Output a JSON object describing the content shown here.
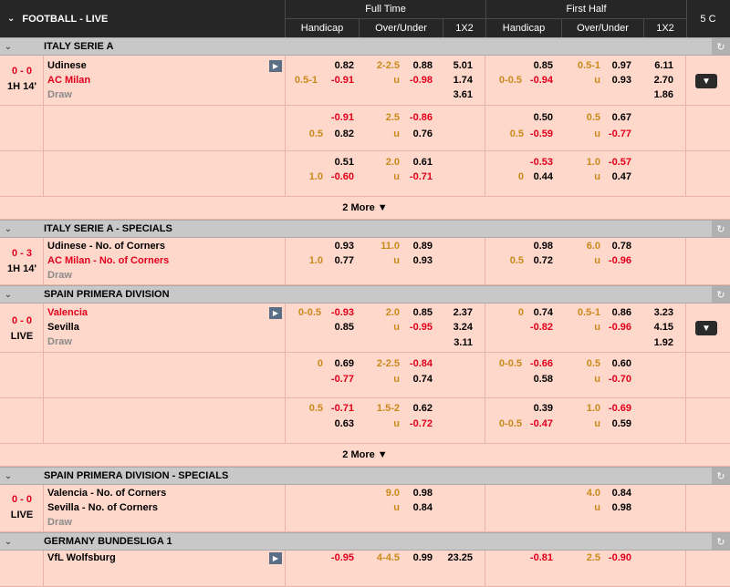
{
  "header": {
    "title": "FOOTBALL - LIVE",
    "full_time": "Full Time",
    "first_half": "First Half",
    "handicap": "Handicap",
    "over_under": "Over/Under",
    "x12": "1X2",
    "count": "5",
    "refresh_glyph": "C"
  },
  "more_label": "2 More ▼",
  "leagues": {
    "l1": "ITALY SERIE A",
    "l2": "ITALY SERIE A - SPECIALS",
    "l3": "SPAIN PRIMERA DIVISION",
    "l4": "SPAIN PRIMERA DIVISION - SPECIALS",
    "l5": "GERMANY BUNDESLIGA 1"
  },
  "m1": {
    "score": "0 - 0",
    "clock": "1H 14'",
    "home": "Udinese",
    "away": "AC Milan",
    "draw": "Draw",
    "r1": {
      "ft_hdp_line": "",
      "ft_hdp": "0.82",
      "ft_ou_line": "2-2.5",
      "ft_ou": "0.88",
      "ft_1x2": "5.01",
      "fh_hdp_line": "",
      "fh_hdp": "0.85",
      "fh_ou_line": "0.5-1",
      "fh_ou": "0.97",
      "fh_1x2": "6.11"
    },
    "r2": {
      "ft_hdp_line": "0.5-1",
      "ft_hdp": "-0.91",
      "ft_ou_line": "u",
      "ft_ou": "-0.98",
      "ft_1x2": "1.74",
      "fh_hdp_line": "0-0.5",
      "fh_hdp": "-0.94",
      "fh_ou_line": "u",
      "fh_ou": "0.93",
      "fh_1x2": "2.70"
    },
    "r3": {
      "ft_1x2": "3.61",
      "fh_1x2": "1.86"
    },
    "alt1": {
      "a_ft_hdp": "-0.91",
      "a_ft_ou_line": "2.5",
      "a_ft_ou": "-0.86",
      "a_fh_hdp": "0.50",
      "a_fh_ou_line": "0.5",
      "a_fh_ou": "0.67",
      "b_ft_hdp_line": "0.5",
      "b_ft_hdp": "0.82",
      "b_ft_ou_line": "u",
      "b_ft_ou": "0.76",
      "b_fh_hdp_line": "0.5",
      "b_fh_hdp": "-0.59",
      "b_fh_ou_line": "u",
      "b_fh_ou": "-0.77"
    },
    "alt2": {
      "a_ft_hdp": "0.51",
      "a_ft_ou_line": "2.0",
      "a_ft_ou": "0.61",
      "a_fh_hdp": "-0.53",
      "a_fh_ou_line": "1.0",
      "a_fh_ou": "-0.57",
      "b_ft_hdp_line": "1.0",
      "b_ft_hdp": "-0.60",
      "b_ft_ou_line": "u",
      "b_ft_ou": "-0.71",
      "b_fh_hdp_line": "0",
      "b_fh_hdp": "0.44",
      "b_fh_ou_line": "u",
      "b_fh_ou": "0.47"
    }
  },
  "m2": {
    "score": "0 - 3",
    "clock": "1H 14'",
    "home": "Udinese - No. of Corners",
    "away": "AC Milan - No. of Corners",
    "draw": "Draw",
    "r1": {
      "ft_hdp": "0.93",
      "ft_ou_line": "11.0",
      "ft_ou": "0.89",
      "fh_hdp": "0.98",
      "fh_ou_line": "6.0",
      "fh_ou": "0.78"
    },
    "r2": {
      "ft_hdp_line": "1.0",
      "ft_hdp": "0.77",
      "ft_ou_line": "u",
      "ft_ou": "0.93",
      "fh_hdp_line": "0.5",
      "fh_hdp": "0.72",
      "fh_ou_line": "u",
      "fh_ou": "-0.96"
    }
  },
  "m3": {
    "score": "0 - 0",
    "clock": "LIVE",
    "home": "Valencia",
    "away": "Sevilla",
    "draw": "Draw",
    "r1": {
      "ft_hdp_line": "0-0.5",
      "ft_hdp": "-0.93",
      "ft_ou_line": "2.0",
      "ft_ou": "0.85",
      "ft_1x2": "2.37",
      "fh_hdp_line": "0",
      "fh_hdp": "0.74",
      "fh_ou_line": "0.5-1",
      "fh_ou": "0.86",
      "fh_1x2": "3.23"
    },
    "r2": {
      "ft_hdp": "0.85",
      "ft_ou_line": "u",
      "ft_ou": "-0.95",
      "ft_1x2": "3.24",
      "fh_hdp": "-0.82",
      "fh_ou_line": "u",
      "fh_ou": "-0.96",
      "fh_1x2": "4.15"
    },
    "r3": {
      "ft_1x2": "3.11",
      "fh_1x2": "1.92"
    },
    "alt1": {
      "a_ft_hdp_line": "0",
      "a_ft_hdp": "0.69",
      "a_ft_ou_line": "2-2.5",
      "a_ft_ou": "-0.84",
      "a_fh_hdp_line": "0-0.5",
      "a_fh_hdp": "-0.66",
      "a_fh_ou_line": "0.5",
      "a_fh_ou": "0.60",
      "b_ft_hdp": "-0.77",
      "b_ft_ou_line": "u",
      "b_ft_ou": "0.74",
      "b_fh_hdp": "0.58",
      "b_fh_ou_line": "u",
      "b_fh_ou": "-0.70"
    },
    "alt2": {
      "a_ft_hdp_line": "0.5",
      "a_ft_hdp": "-0.71",
      "a_ft_ou_line": "1.5-2",
      "a_ft_ou": "0.62",
      "a_fh_hdp": "0.39",
      "a_fh_ou_line": "1.0",
      "a_fh_ou": "-0.69",
      "b_ft_hdp": "0.63",
      "b_ft_ou_line": "u",
      "b_ft_ou": "-0.72",
      "b_fh_hdp_line": "0-0.5",
      "b_fh_hdp": "-0.47",
      "b_fh_ou_line": "u",
      "b_fh_ou": "0.59"
    }
  },
  "m4": {
    "score": "0 - 0",
    "clock": "LIVE",
    "home": "Valencia - No. of Corners",
    "away": "Sevilla - No. of Corners",
    "draw": "Draw",
    "r1": {
      "ft_ou_line": "9.0",
      "ft_ou": "0.98",
      "fh_ou_line": "4.0",
      "fh_ou": "0.84"
    },
    "r2": {
      "ft_ou_line": "u",
      "ft_ou": "0.84",
      "fh_ou_line": "u",
      "fh_ou": "0.98"
    }
  },
  "m5": {
    "home": "VfL Wolfsburg",
    "r1": {
      "ft_hdp": "-0.95",
      "ft_ou_line": "4-4.5",
      "ft_ou": "0.99",
      "ft_1x2": "23.25",
      "fh_hdp": "-0.81",
      "fh_ou_line": "2.5",
      "fh_ou": "-0.90"
    }
  }
}
